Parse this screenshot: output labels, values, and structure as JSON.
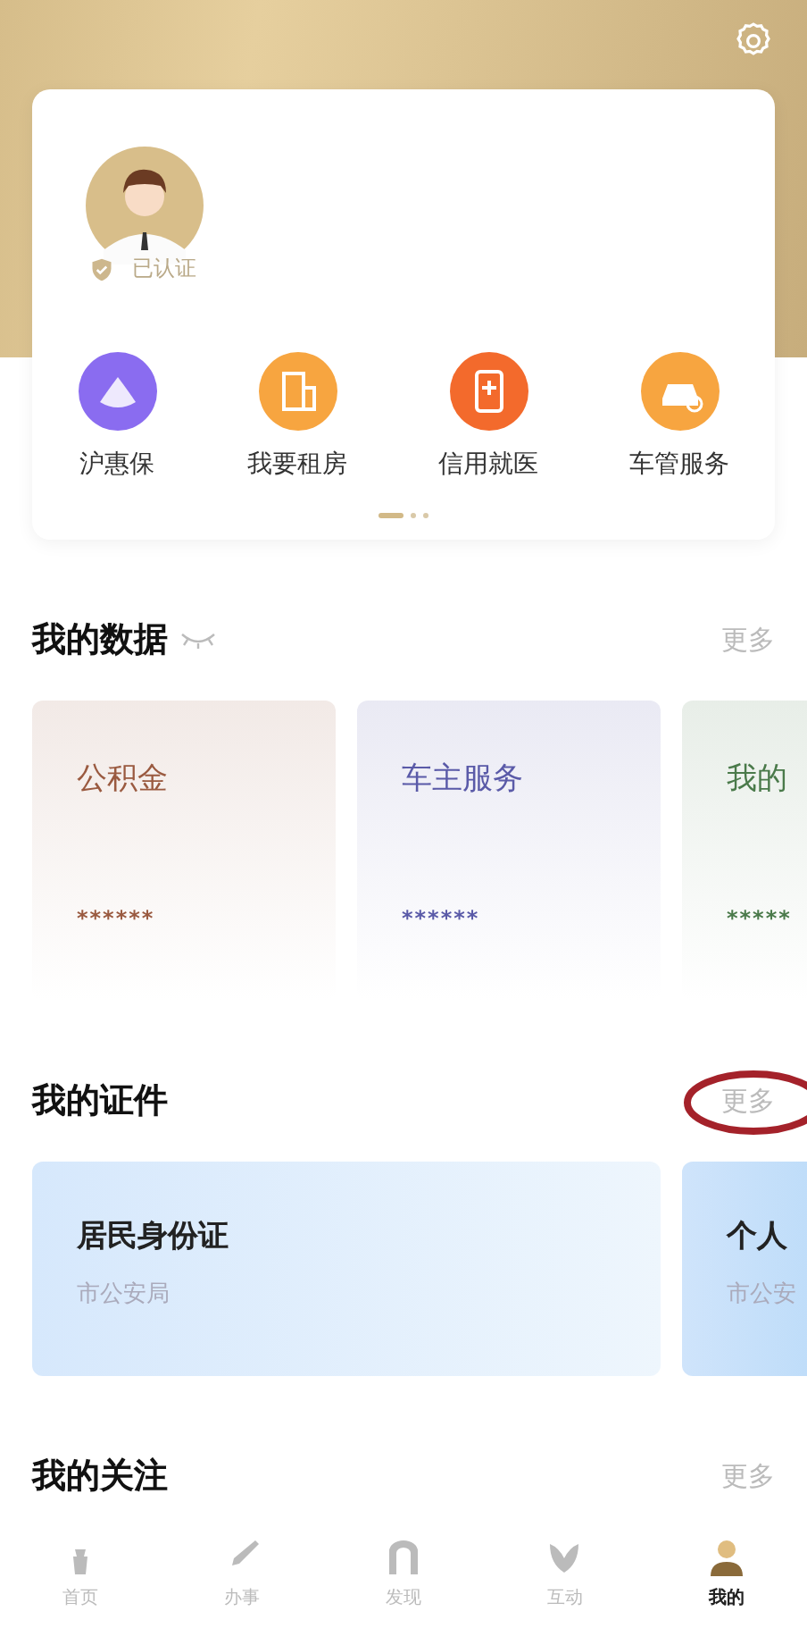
{
  "profile": {
    "verified_label": "已认证"
  },
  "shortcuts": [
    {
      "label": "沪惠保",
      "color": "#8a6cf0"
    },
    {
      "label": "我要租房",
      "color": "#f7a540"
    },
    {
      "label": "信用就医",
      "color": "#f36a2c"
    },
    {
      "label": "车管服务",
      "color": "#f7a540"
    }
  ],
  "pager": [
    {
      "selected": true
    },
    {
      "selected": false
    },
    {
      "selected": false
    }
  ],
  "my_data": {
    "title": "我的数据",
    "more": "更多",
    "cards": [
      {
        "title": "公积金",
        "value": "******",
        "color": "#9a5a40"
      },
      {
        "title": "车主服务",
        "value": "******",
        "color": "#5a5aa8"
      },
      {
        "title": "我的",
        "value": "*****",
        "color": "#4a7a4a"
      }
    ]
  },
  "my_certificates": {
    "title": "我的证件",
    "more": "更多",
    "more_circled": true,
    "cards": [
      {
        "title": "居民身份证",
        "issuer": "市公安局"
      },
      {
        "title": "个人",
        "issuer": "市公安"
      }
    ]
  },
  "my_follows": {
    "title": "我的关注",
    "more": "更多"
  },
  "tab_bar": [
    {
      "label": "首页",
      "selected": false
    },
    {
      "label": "办事",
      "selected": false
    },
    {
      "label": "发现",
      "selected": false
    },
    {
      "label": "互动",
      "selected": false
    },
    {
      "label": "我的",
      "selected": true
    }
  ]
}
